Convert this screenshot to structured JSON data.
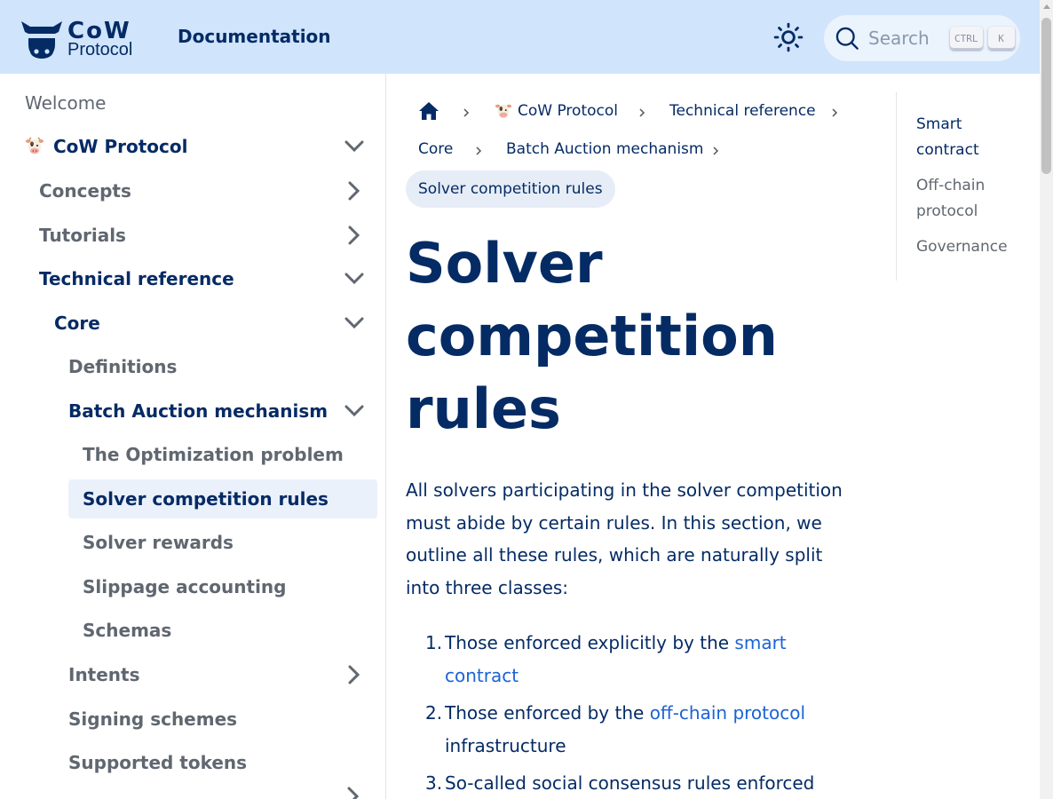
{
  "navbar": {
    "logo_word": "CoW",
    "logo_sub": "Protocol",
    "title": "Documentation",
    "search_placeholder": "Search",
    "kbd_ctrl": "CTRL",
    "kbd_k": "K"
  },
  "sidebar": {
    "items": [
      {
        "label": "Welcome"
      },
      {
        "label": "CoW Protocol"
      },
      {
        "label": "Concepts"
      },
      {
        "label": "Tutorials"
      },
      {
        "label": "Technical reference"
      },
      {
        "label": "Core"
      },
      {
        "label": "Definitions"
      },
      {
        "label": "Batch Auction mechanism"
      },
      {
        "label": "The Optimization problem"
      },
      {
        "label": "Solver competition rules"
      },
      {
        "label": "Solver rewards"
      },
      {
        "label": "Slippage accounting"
      },
      {
        "label": "Schemas"
      },
      {
        "label": "Intents"
      },
      {
        "label": "Signing schemes"
      },
      {
        "label": "Supported tokens"
      }
    ]
  },
  "breadcrumbs": {
    "items": [
      "CoW Protocol",
      "Technical reference",
      "Core",
      "Batch Auction mechanism"
    ],
    "current": "Solver competition rules"
  },
  "main": {
    "title": "Solver competition rules",
    "intro": "All solvers participating in the solver competition must abide by certain rules. In this section, we outline all these rules, which are naturally split into three classes:",
    "rules": [
      {
        "num": "1.",
        "text": "Those enforced explicitly by the ",
        "link": "smart contract",
        "after": ""
      },
      {
        "num": "2.",
        "text": "Those enforced by the ",
        "link": "off-chain protocol",
        "after": " infrastructure"
      },
      {
        "num": "3.",
        "text": "So-called social consensus rules enforced by",
        "link": "",
        "after": ""
      }
    ]
  },
  "toc": {
    "items": [
      "Smart contract",
      "Off-chain protocol",
      "Governance"
    ]
  },
  "colors": {
    "navbar_bg": "#d0e4fc",
    "text_dark": "#052b65",
    "link": "#1c63d5",
    "active_bg": "#ebf1fb"
  }
}
